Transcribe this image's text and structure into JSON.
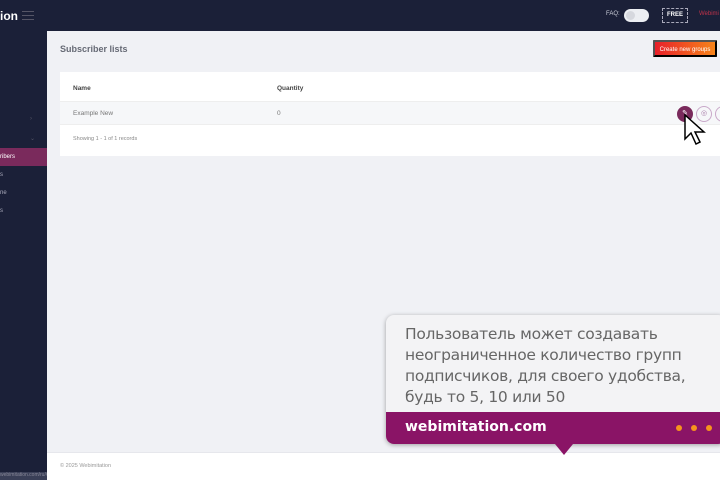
{
  "topbar": {
    "logo": "ion",
    "faq_label": "FAQ:",
    "plan_badge": "FREE",
    "user_name": "Webimi"
  },
  "sidebar": {
    "items": [
      {
        "label": "ribers",
        "active": true
      },
      {
        "label": "s"
      },
      {
        "label": "ne"
      },
      {
        "label": "s"
      }
    ],
    "footer_text": "webimitation.com/ru/#subs"
  },
  "page": {
    "title": "Subscriber lists",
    "create_button": "Create new groups"
  },
  "table": {
    "headers": [
      "Name",
      "Quantity"
    ],
    "rows": [
      {
        "name": "Example New",
        "quantity": "0"
      }
    ],
    "summary": "Showing 1 - 1 of 1 records"
  },
  "footer": {
    "copyright": "© 2025 Webimitation"
  },
  "callout": {
    "text": "Пользователь может создавать неограниченное количество групп подписчиков, для своего удобства, будь то 5, 10 или 50",
    "site": "webimitation.com"
  },
  "colors": {
    "brand": "#8a1466",
    "accent": "#f7941d",
    "sidebar": "#1b2038"
  }
}
